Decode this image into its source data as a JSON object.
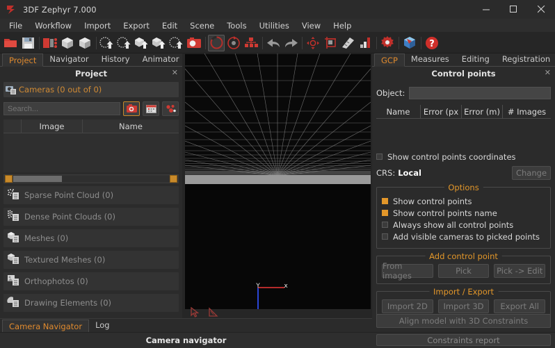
{
  "window": {
    "title": "3DF Zephyr 7.000",
    "logo_icon": "zephyr-logo-icon",
    "controls": {
      "minimize": "minimize-icon",
      "maximize": "maximize-icon",
      "close": "close-icon"
    }
  },
  "menubar": {
    "items": [
      "File",
      "Workflow",
      "Import",
      "Export",
      "Edit",
      "Scene",
      "Tools",
      "Utilities",
      "View",
      "Help"
    ]
  },
  "toolbar": {
    "items": [
      {
        "name": "open-project-icon",
        "type": "icon"
      },
      {
        "name": "save-project-icon",
        "type": "icon"
      },
      {
        "sep": true
      },
      {
        "name": "import-photos-icon",
        "type": "icon"
      },
      {
        "name": "sparse-reconstruction-icon",
        "type": "icon"
      },
      {
        "name": "dense-reconstruction-icon",
        "type": "icon"
      },
      {
        "sep": true
      },
      {
        "name": "extract-point-cloud-icon",
        "type": "icon"
      },
      {
        "name": "generate-dense-cloud-icon",
        "type": "icon"
      },
      {
        "name": "generate-mesh-icon",
        "type": "icon"
      },
      {
        "name": "generate-textured-mesh-icon",
        "type": "icon"
      },
      {
        "name": "generate-orthophoto-icon",
        "type": "icon"
      },
      {
        "name": "camera-icon",
        "type": "icon"
      },
      {
        "sep": true
      },
      {
        "name": "render-circle-icon",
        "type": "icon",
        "framed": true
      },
      {
        "name": "rotate-view-icon",
        "type": "icon"
      },
      {
        "name": "structure-nodes-icon",
        "type": "icon"
      },
      {
        "sep": true
      },
      {
        "name": "undo-icon",
        "type": "icon"
      },
      {
        "name": "redo-icon",
        "type": "icon"
      },
      {
        "sep": true
      },
      {
        "name": "orbit-icon",
        "type": "icon"
      },
      {
        "name": "crop-icon",
        "type": "icon"
      },
      {
        "name": "measure-icon",
        "type": "icon"
      },
      {
        "name": "chart-icon",
        "type": "icon"
      },
      {
        "sep": true
      },
      {
        "name": "settings-gear-icon",
        "type": "icon"
      },
      {
        "sep": true
      },
      {
        "name": "cube-colored-icon",
        "type": "icon"
      },
      {
        "sep": true
      },
      {
        "name": "help-icon",
        "type": "icon"
      }
    ]
  },
  "left_panel": {
    "tabs": [
      {
        "label": "Project",
        "active": true
      },
      {
        "label": "Navigator",
        "active": false
      },
      {
        "label": "History",
        "active": false
      },
      {
        "label": "Animator",
        "active": false
      }
    ],
    "header": {
      "title": "Project",
      "close_icon": "close-icon"
    },
    "cameras": {
      "icon": "cameras-icon",
      "label": "Cameras (0 out of 0)"
    },
    "search": {
      "placeholder": "Search...",
      "value": "",
      "buttons": [
        {
          "name": "camera-filter-button",
          "icon": "camera-circle-icon",
          "selected": true
        },
        {
          "name": "calendar-filter-button",
          "icon": "calendar-icon",
          "selected": false
        },
        {
          "name": "points-filter-button",
          "icon": "keypoints-icon",
          "selected": false
        }
      ]
    },
    "image_table": {
      "columns": [
        "",
        "Image",
        "Name"
      ]
    },
    "objects": [
      {
        "label": "Sparse Point Cloud (0)",
        "icon": "sparse-point-cloud-icon"
      },
      {
        "label": "Dense Point Clouds (0)",
        "icon": "dense-point-cloud-icon"
      },
      {
        "label": "Meshes (0)",
        "icon": "mesh-icon"
      },
      {
        "label": "Textured Meshes (0)",
        "icon": "textured-mesh-icon"
      },
      {
        "label": "Orthophotos (0)",
        "icon": "orthophoto-icon"
      },
      {
        "label": "Drawing Elements (0)",
        "icon": "drawing-elements-icon"
      }
    ]
  },
  "viewport": {
    "axis_gizmo": {
      "x_label": "x",
      "y_label": "Y"
    },
    "tools": [
      {
        "name": "select-tool-icon"
      },
      {
        "name": "measure-tool-icon"
      }
    ]
  },
  "right_panel": {
    "tabs": [
      {
        "label": "GCP",
        "active": true
      },
      {
        "label": "Measures",
        "active": false
      },
      {
        "label": "Editing",
        "active": false
      },
      {
        "label": "Registration",
        "active": false
      }
    ],
    "header": {
      "title": "Control points",
      "close_icon": "close-icon"
    },
    "object": {
      "label": "Object:",
      "value": ""
    },
    "table": {
      "columns": [
        "Name",
        "Error (px",
        "Error (m)",
        "# Images"
      ],
      "rows": []
    },
    "show_coords": {
      "label": "Show control points coordinates",
      "checked": false
    },
    "crs": {
      "label": "CRS:",
      "value": "Local",
      "change_button": "Change"
    },
    "options": {
      "title": "Options",
      "items": [
        {
          "label": "Show control points",
          "checked": true
        },
        {
          "label": "Show control points name",
          "checked": true
        },
        {
          "label": "Always show all control points",
          "checked": false
        },
        {
          "label": "Add visible cameras to picked points",
          "checked": false
        }
      ]
    },
    "add_control_point": {
      "title": "Add control point",
      "buttons": [
        "From images",
        "Pick",
        "Pick -> Edit"
      ]
    },
    "import_export": {
      "title": "Import / Export",
      "buttons": [
        "Import 2D",
        "Import 3D",
        "Export All"
      ]
    },
    "align_button": "Align model with 3D Constraints",
    "constraints_report_button": "Constraints report"
  },
  "bottom": {
    "tabs": [
      {
        "label": "Camera Navigator",
        "active": true
      },
      {
        "label": "Log",
        "active": false
      }
    ],
    "status_text": "Camera navigator"
  },
  "colors": {
    "accent_orange": "#e3972a",
    "accent_red": "#d03a33",
    "bg": "#2b2b2b",
    "panel": "#333333",
    "viewport_bg": "#0a0a0a"
  }
}
